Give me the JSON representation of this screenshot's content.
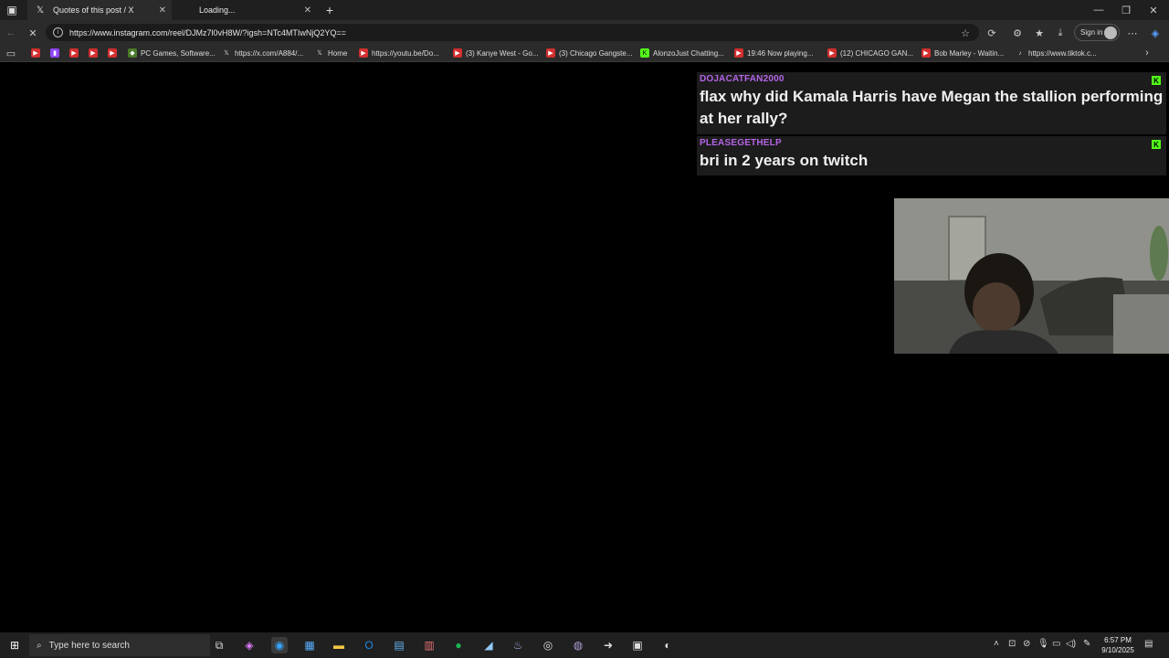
{
  "tabs": [
    {
      "title": "Quotes of this post / X",
      "icon": "x-logo-icon"
    },
    {
      "title": "Loading...",
      "icon": "loading-icon"
    }
  ],
  "address": {
    "url": "https://www.instagram.com/reel/DJMz7l0vH8W/?igsh=NTc4MTIwNjQ2YQ=="
  },
  "toolbar": {
    "signin_label": "Sign in"
  },
  "bookmarks": [
    {
      "label": "",
      "icon": "youtube-icon"
    },
    {
      "label": "",
      "icon": "twitch-icon"
    },
    {
      "label": "",
      "icon": "youtube-icon"
    },
    {
      "label": "",
      "icon": "youtube-icon"
    },
    {
      "label": "",
      "icon": "youtube-icon"
    },
    {
      "label": "PC Games, Software...",
      "icon": "games-icon"
    },
    {
      "label": "https://x.com/A884/...",
      "icon": "x-logo-icon"
    },
    {
      "label": "Home",
      "icon": "x-logo-icon"
    },
    {
      "label": "https://youtu.be/Do...",
      "icon": "youtube-icon"
    },
    {
      "label": "(3) Kanye West - Go...",
      "icon": "youtube-icon"
    },
    {
      "label": "(3) Chicago Gangste...",
      "icon": "youtube-icon"
    },
    {
      "label": "AlonzoJust Chatting...",
      "icon": "kick-icon"
    },
    {
      "label": "19:46 Now playing...",
      "icon": "youtube-icon"
    },
    {
      "label": "(12) CHICAGO GAN...",
      "icon": "youtube-icon"
    },
    {
      "label": "Bob Marley - Waitin...",
      "icon": "youtube-icon"
    },
    {
      "label": "https://www.tiktok.c...",
      "icon": "tiktok-icon"
    }
  ],
  "chat": [
    {
      "user": "DOJACATFAN2000",
      "text": "flax why did Kamala Harris have Megan the stallion performing at her rally?"
    },
    {
      "user": "PLEASEGETHELP",
      "text": "bri in 2 years on twitch"
    }
  ],
  "taskbar": {
    "search_placeholder": "Type here to search",
    "time": "6:57 PM",
    "date": "9/10/2025"
  },
  "colors": {
    "chat_username": "#b464e6",
    "kick_badge": "#53fc18",
    "page_bg": "#000000"
  }
}
